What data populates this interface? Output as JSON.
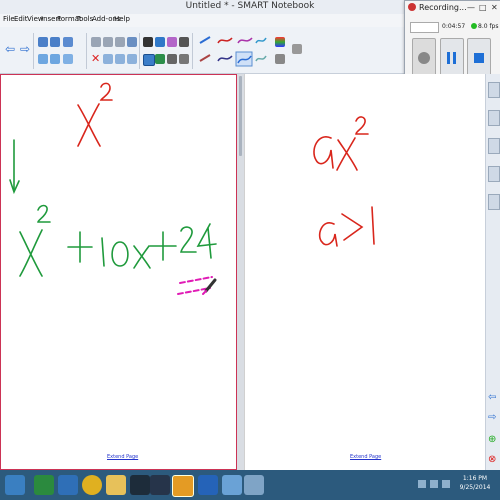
{
  "window": {
    "title": "Untitled * - SMART Notebook"
  },
  "menu": [
    "File",
    "Edit",
    "View",
    "Insert",
    "Format",
    "Tools",
    "Add-ons",
    "Help"
  ],
  "recording": {
    "title": "Recording...",
    "time": "0:04:57",
    "fps": "8.0 fps"
  },
  "pages": {
    "left_extend": "Extend Page",
    "right_extend": "Extend Page"
  },
  "ink": {
    "left_top": "x²",
    "left_expr": "x² + 10x + 24",
    "right_top": "ax²",
    "right_cond": "a>1",
    "colors": {
      "red": "#d9261c",
      "green": "#1f9a3c",
      "magenta": "#e01ab5"
    }
  },
  "taskbar": {
    "time": "1:16 PM",
    "date": "9/25/2014"
  }
}
